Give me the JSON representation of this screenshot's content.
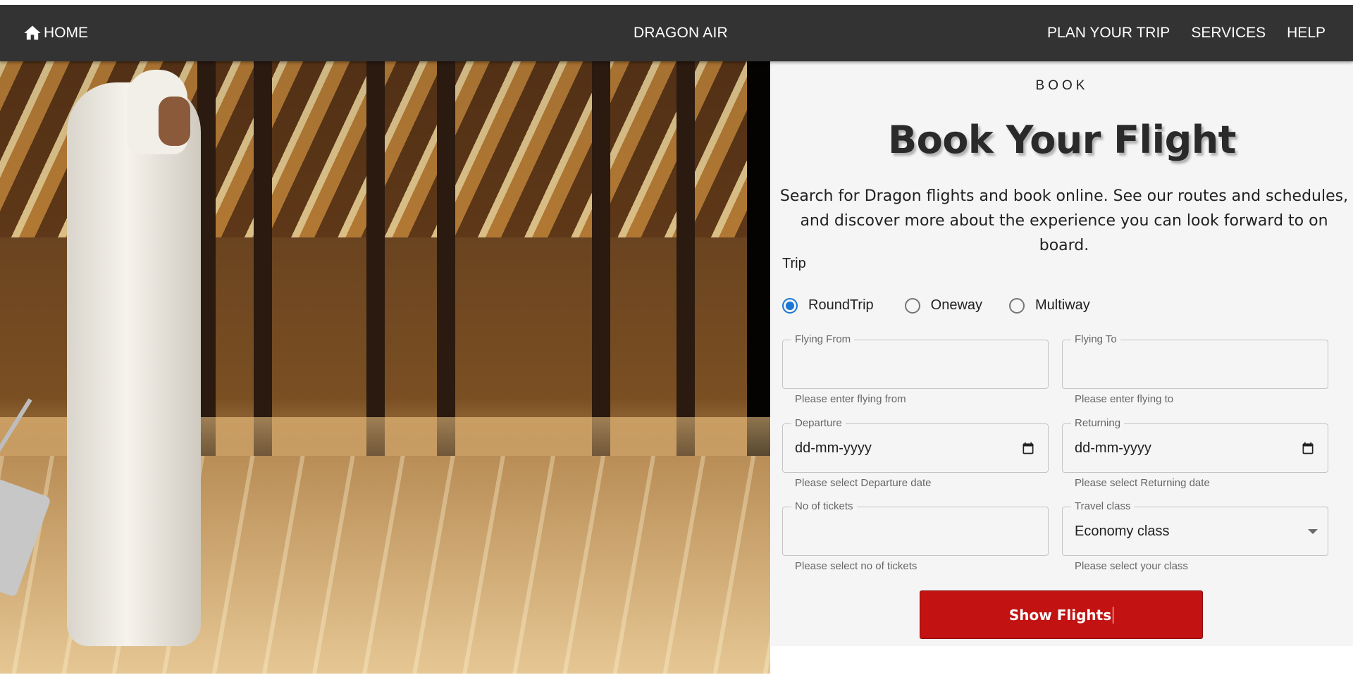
{
  "nav": {
    "home_label": "HOME",
    "brand": "DRAGON AIR",
    "links": [
      "PLAN YOUR TRIP",
      "SERVICES",
      "HELP"
    ]
  },
  "hero": {
    "image": "Man in white thobe walking with luggage through an airport lounge"
  },
  "booking": {
    "eyebrow": "BOOK",
    "title": "Book Your Flight",
    "intro": "Search for Dragon flights and book online. See our routes and schedules, and discover more about the experience you can look forward to on board.",
    "trip_label": "Trip",
    "trip_options": [
      "RoundTrip",
      "Oneway",
      "Multiway"
    ],
    "trip_selected": "RoundTrip",
    "fields": {
      "flying_from": {
        "label": "Flying From",
        "value": "",
        "helper": "Please enter flying from"
      },
      "flying_to": {
        "label": "Flying To",
        "value": "",
        "helper": "Please enter flying to"
      },
      "departure": {
        "label": "Departure",
        "placeholder": "dd-mm-yyyy",
        "helper": "Please select Departure date"
      },
      "returning": {
        "label": "Returning",
        "placeholder": "dd-mm-yyyy",
        "helper": "Please select Returning date"
      },
      "tickets": {
        "label": "No of tickets",
        "value": "",
        "helper": "Please select no of tickets"
      },
      "travel_class": {
        "label": "Travel class",
        "value": "Economy class",
        "helper": "Please select your class"
      }
    },
    "submit_label": "Show Flights"
  },
  "colors": {
    "navbar": "#333333",
    "accent": "#1976d2",
    "submit": "#c21212",
    "panel": "#f5f5f5"
  },
  "icons": {
    "home": "home-icon",
    "calendar": "calendar-icon",
    "dropdown": "dropdown-arrow-icon"
  }
}
